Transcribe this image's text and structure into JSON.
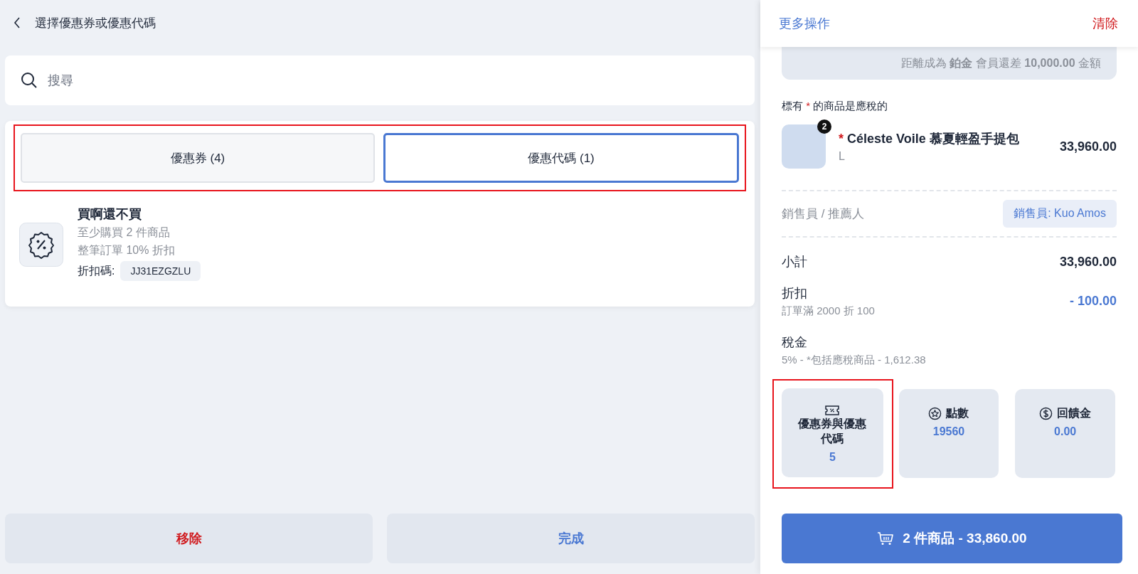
{
  "header": {
    "title": "選擇優惠券或優惠代碼"
  },
  "search": {
    "placeholder": "搜尋"
  },
  "tabs": {
    "highlighted": true,
    "items": [
      {
        "label": "優惠券 (4)",
        "selected": false
      },
      {
        "label": "優惠代碼 (1)",
        "selected": true
      }
    ]
  },
  "codes": [
    {
      "title": "買啊還不買",
      "conditions": [
        "至少購買 2 件商品",
        "整筆訂單 10% 折扣"
      ],
      "code_label": "折扣碼:",
      "code": "JJ31EZGZLU"
    }
  ],
  "footer_buttons": [
    {
      "label": "移除",
      "kind": "danger"
    },
    {
      "label": "完成",
      "kind": "primary"
    }
  ],
  "cart": {
    "more_actions": "更多操作",
    "clear": "清除",
    "member_note": "距離成為 **鉑金** 會員還差 **10,000.00** 金額",
    "tax_note": {
      "before": "標有",
      "mark": "*",
      "after": "的商品是應稅的"
    },
    "items": [
      {
        "mark": "*",
        "name": "Céleste Voile 慕夏輕盈手提包",
        "variant": "L",
        "quantity": "2",
        "price": "33,960.00"
      }
    ],
    "staff": {
      "label": "銷售員 / 推薦人",
      "value": "銷售員: Kuo Amos"
    },
    "summary": [
      {
        "kind": "plain",
        "label": "小計",
        "value": "33,960.00"
      },
      {
        "kind": "discount",
        "label": "折扣",
        "detail": "訂單滿 2000 折 100",
        "value": "- 100.00"
      },
      {
        "kind": "plain",
        "label": "稅金",
        "detail": "5% - *包括應稅商品 - 1,612.38"
      }
    ],
    "tiles": [
      {
        "kind": "ticket",
        "label": "優惠券與優惠代碼",
        "value": "5",
        "highlighted": true
      },
      {
        "kind": "star",
        "label": "點數",
        "value": "19560",
        "highlighted": false
      },
      {
        "kind": "dollar",
        "label": "回饋金",
        "value": "0.00",
        "highlighted": false
      }
    ],
    "checkout": "2 件商品 - 33,860.00"
  }
}
